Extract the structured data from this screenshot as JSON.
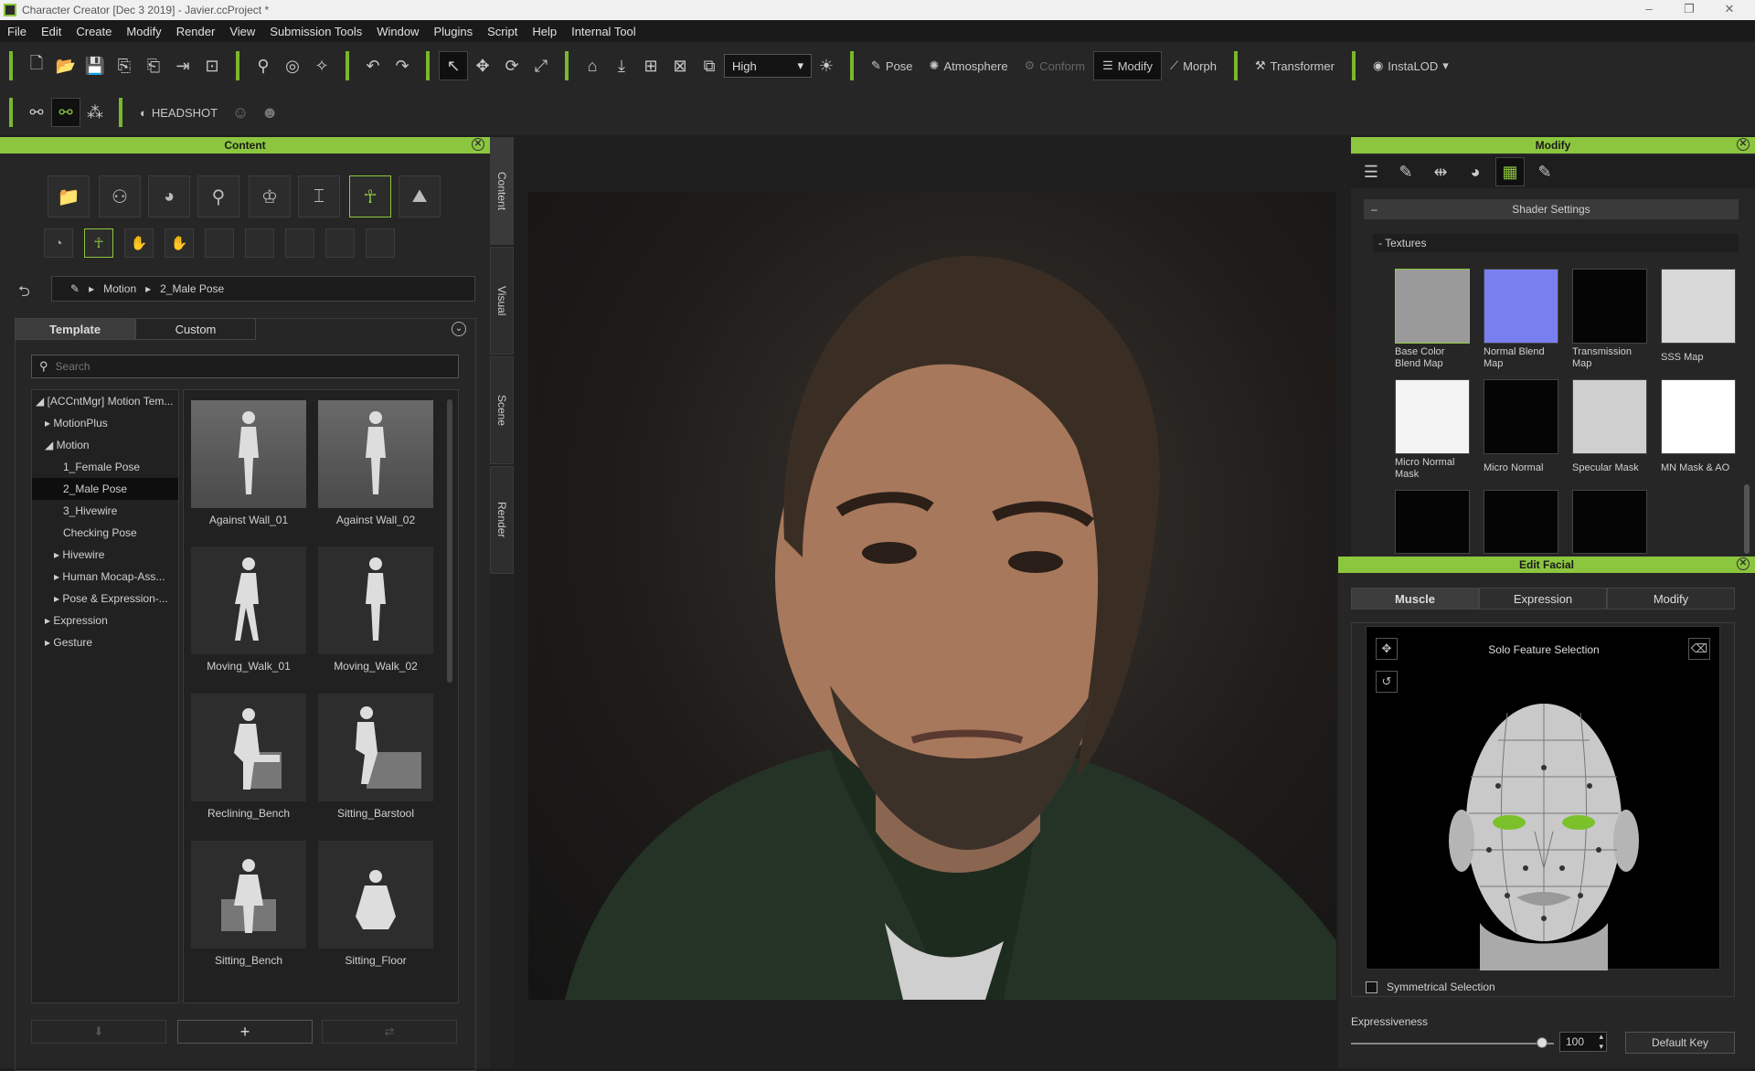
{
  "window": {
    "title": "Character Creator [Dec  3 2019] - Javier.ccProject *"
  },
  "menu": [
    "File",
    "Edit",
    "Create",
    "Modify",
    "Render",
    "View",
    "Submission Tools",
    "Window",
    "Plugins",
    "Script",
    "Help",
    "Internal Tool"
  ],
  "toolbar": {
    "quality": "High",
    "pose": "Pose",
    "atmosphere": "Atmosphere",
    "conform": "Conform",
    "modify": "Modify",
    "morph": "Morph",
    "transformer": "Transformer",
    "instalod": "InstaLOD",
    "headshot": "HEADSHOT"
  },
  "content": {
    "title": "Content",
    "breadcrumb": [
      "Motion",
      "2_Male Pose"
    ],
    "tabs": [
      "Template",
      "Custom"
    ],
    "search_placeholder": "Search",
    "tree": [
      {
        "label": "[ACCntMgr] Motion Tem...",
        "arrow": "◢"
      },
      {
        "label": "MotionPlus",
        "arrow": "▸"
      },
      {
        "label": "Motion",
        "arrow": "◢"
      },
      {
        "label": "1_Female Pose",
        "arrow": ""
      },
      {
        "label": "2_Male Pose",
        "arrow": ""
      },
      {
        "label": "3_Hivewire",
        "arrow": ""
      },
      {
        "label": "Checking Pose",
        "arrow": ""
      },
      {
        "label": "Hivewire",
        "arrow": "▸"
      },
      {
        "label": "Human Mocap-Ass...",
        "arrow": "▸"
      },
      {
        "label": "Pose & Expression-...",
        "arrow": "▸"
      },
      {
        "label": "Expression",
        "arrow": "▸"
      },
      {
        "label": "Gesture",
        "arrow": "▸"
      }
    ],
    "thumbnails": [
      "Against Wall_01",
      "Against Wall_02",
      "Moving_Walk_01",
      "Moving_Walk_02",
      "Reclining_Bench",
      "Sitting_Barstool",
      "Sitting_Bench",
      "Sitting_Floor"
    ]
  },
  "side_tabs": [
    "Content",
    "Visual",
    "Scene",
    "Render"
  ],
  "modify": {
    "title": "Modify",
    "shader_settings": "Shader Settings",
    "textures_label": "Textures",
    "textures": [
      {
        "label": "Base Color Blend Map",
        "color": "#9a9a9a"
      },
      {
        "label": "Normal Blend Map",
        "color": "#7a7ff0"
      },
      {
        "label": "Transmission Map",
        "color": "#050505"
      },
      {
        "label": "SSS Map",
        "color": "#d8d8d8"
      },
      {
        "label": "Micro Normal Mask",
        "color": "#f4f4f4"
      },
      {
        "label": "Micro Normal",
        "color": "#050505"
      },
      {
        "label": "Specular Mask",
        "color": "#cfcfcf"
      },
      {
        "label": "MN Mask & AO",
        "color": "#ffffff"
      }
    ]
  },
  "edit_facial": {
    "title": "Edit Facial",
    "tabs": [
      "Muscle",
      "Expression",
      "Modify"
    ],
    "solo": "Solo Feature Selection",
    "symmetrical": "Symmetrical Selection",
    "expressiveness_label": "Expressiveness",
    "expressiveness_value": "100",
    "default_key": "Default Key"
  }
}
